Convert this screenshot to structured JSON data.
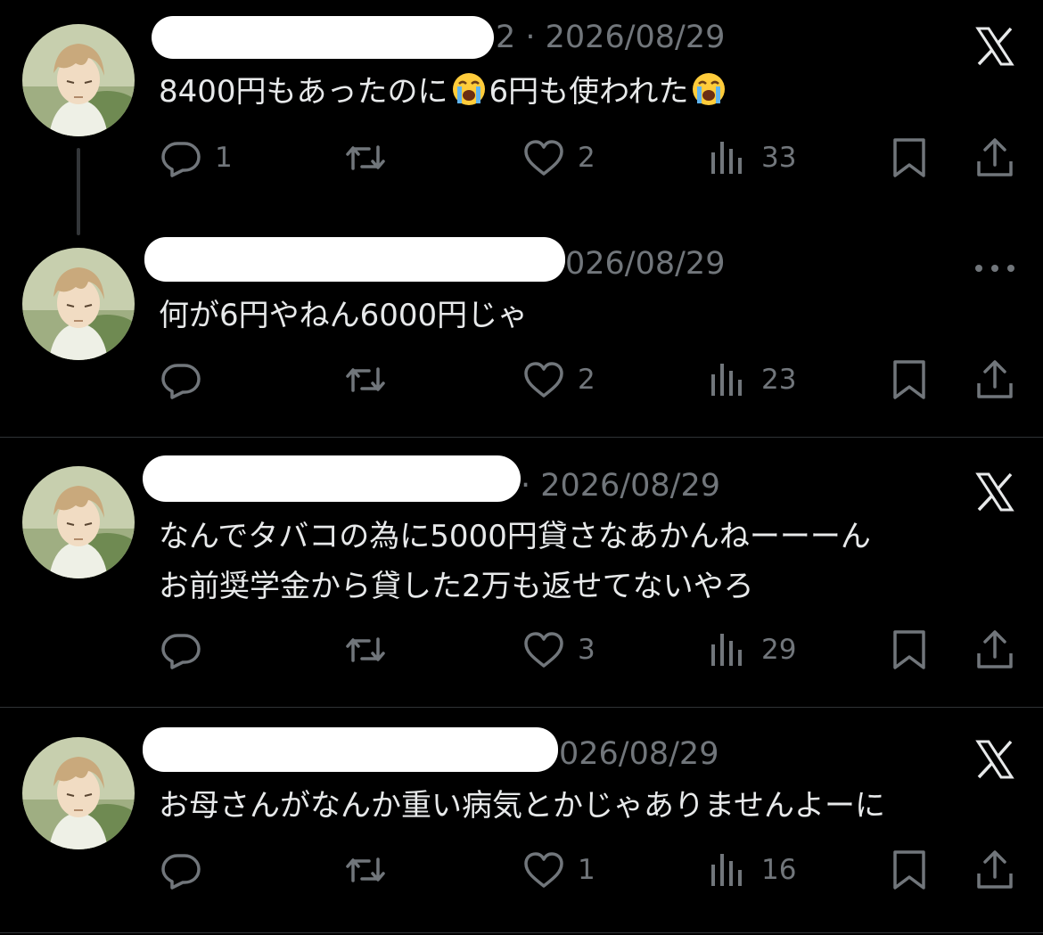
{
  "posts": [
    {
      "meta": "2 · 2026/08/29",
      "text_parts": [
        "8400円もあったのに",
        "6円も使われた"
      ],
      "emoji": "loudly-crying-face",
      "replies": "1",
      "likes": "2",
      "views": "33",
      "top_icon": "x-logo-icon"
    },
    {
      "meta": "026/08/29",
      "text_lines": [
        "何が6円やねん6000円じゃ"
      ],
      "replies": "",
      "likes": "2",
      "views": "23",
      "top_icon": "more-icon"
    },
    {
      "meta": "· 2026/08/29",
      "text_lines": [
        "なんでタバコの為に5000円貸さなあかんねーーーん",
        "お前奨学金から貸した2万も返せてないやろ"
      ],
      "replies": "",
      "likes": "3",
      "views": "29",
      "top_icon": "x-logo-icon"
    },
    {
      "meta": "026/08/29",
      "text_lines": [
        "お母さんがなんか重い病気とかじゃありませんよーに"
      ],
      "replies": "",
      "likes": "1",
      "views": "16",
      "top_icon": "x-logo-icon"
    }
  ],
  "colors": {
    "background": "#000000",
    "text": "#e7e9ea",
    "muted": "#71767b",
    "divider": "#2f3336"
  }
}
